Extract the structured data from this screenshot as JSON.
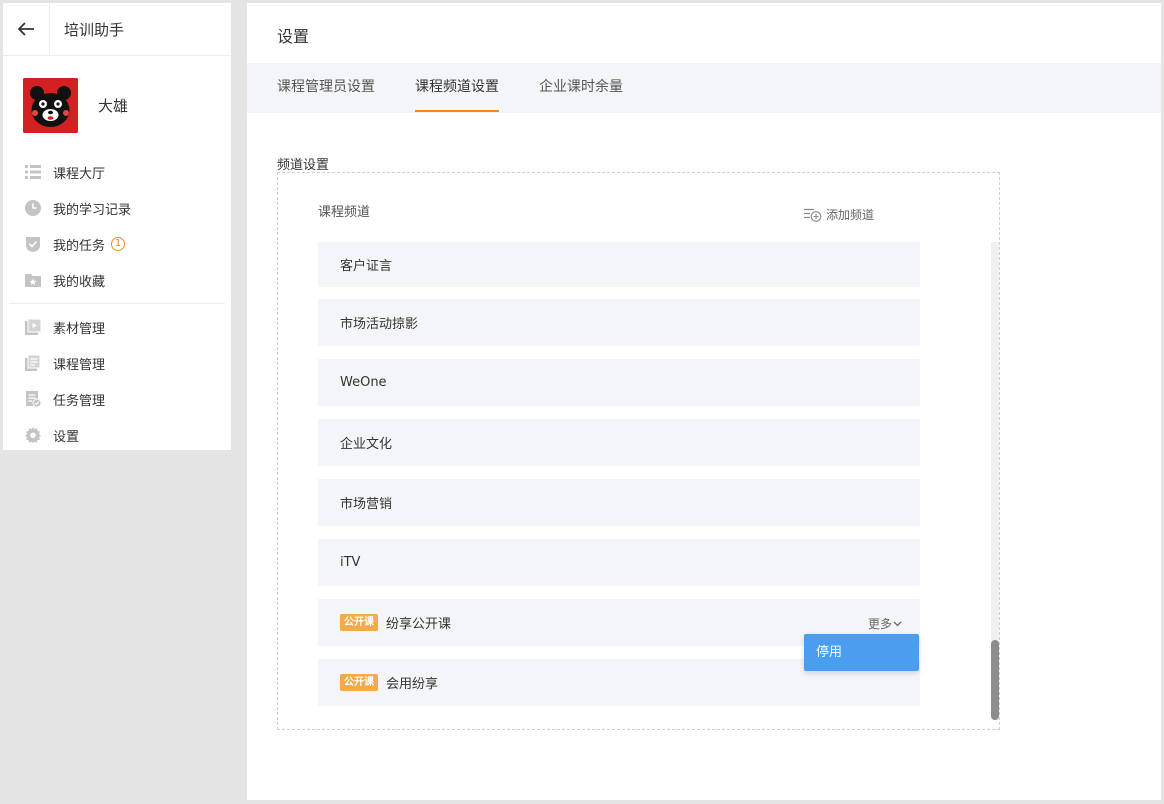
{
  "sidebar": {
    "app_title": "培训助手",
    "username": "大雄",
    "items": [
      {
        "label": "课程大厅",
        "icon": "list-icon"
      },
      {
        "label": "我的学习记录",
        "icon": "clock-icon"
      },
      {
        "label": "我的任务",
        "icon": "shield-check-icon",
        "badge": "1"
      },
      {
        "label": "我的收藏",
        "icon": "folder-star-icon"
      },
      {
        "label": "素材管理",
        "icon": "video-icon"
      },
      {
        "label": "课程管理",
        "icon": "document-icon"
      },
      {
        "label": "任务管理",
        "icon": "task-doc-icon"
      },
      {
        "label": "设置",
        "icon": "gear-icon"
      }
    ]
  },
  "main": {
    "title": "设置",
    "tabs": [
      {
        "label": "课程管理员设置",
        "active": false
      },
      {
        "label": "课程频道设置",
        "active": true
      },
      {
        "label": "企业课时余量",
        "active": false
      }
    ],
    "section_label": "频道设置",
    "box_label": "课程频道",
    "add_channel_label": "添加频道",
    "channels": [
      {
        "name": "客户证言"
      },
      {
        "name": "市场活动掠影"
      },
      {
        "name": "WeOne"
      },
      {
        "name": "企业文化"
      },
      {
        "name": "市场营销"
      },
      {
        "name": "iTV"
      },
      {
        "name": "纷享公开课",
        "tag": "公开课",
        "more_label": "更多"
      },
      {
        "name": "会用纷享",
        "tag": "公开课"
      }
    ],
    "dropdown": {
      "item": "停用"
    }
  },
  "colors": {
    "accent": "#f08a1c",
    "tag_bg": "#f5a947",
    "dropdown_bg": "#4b9df0",
    "row_bg": "#f4f5f9"
  }
}
